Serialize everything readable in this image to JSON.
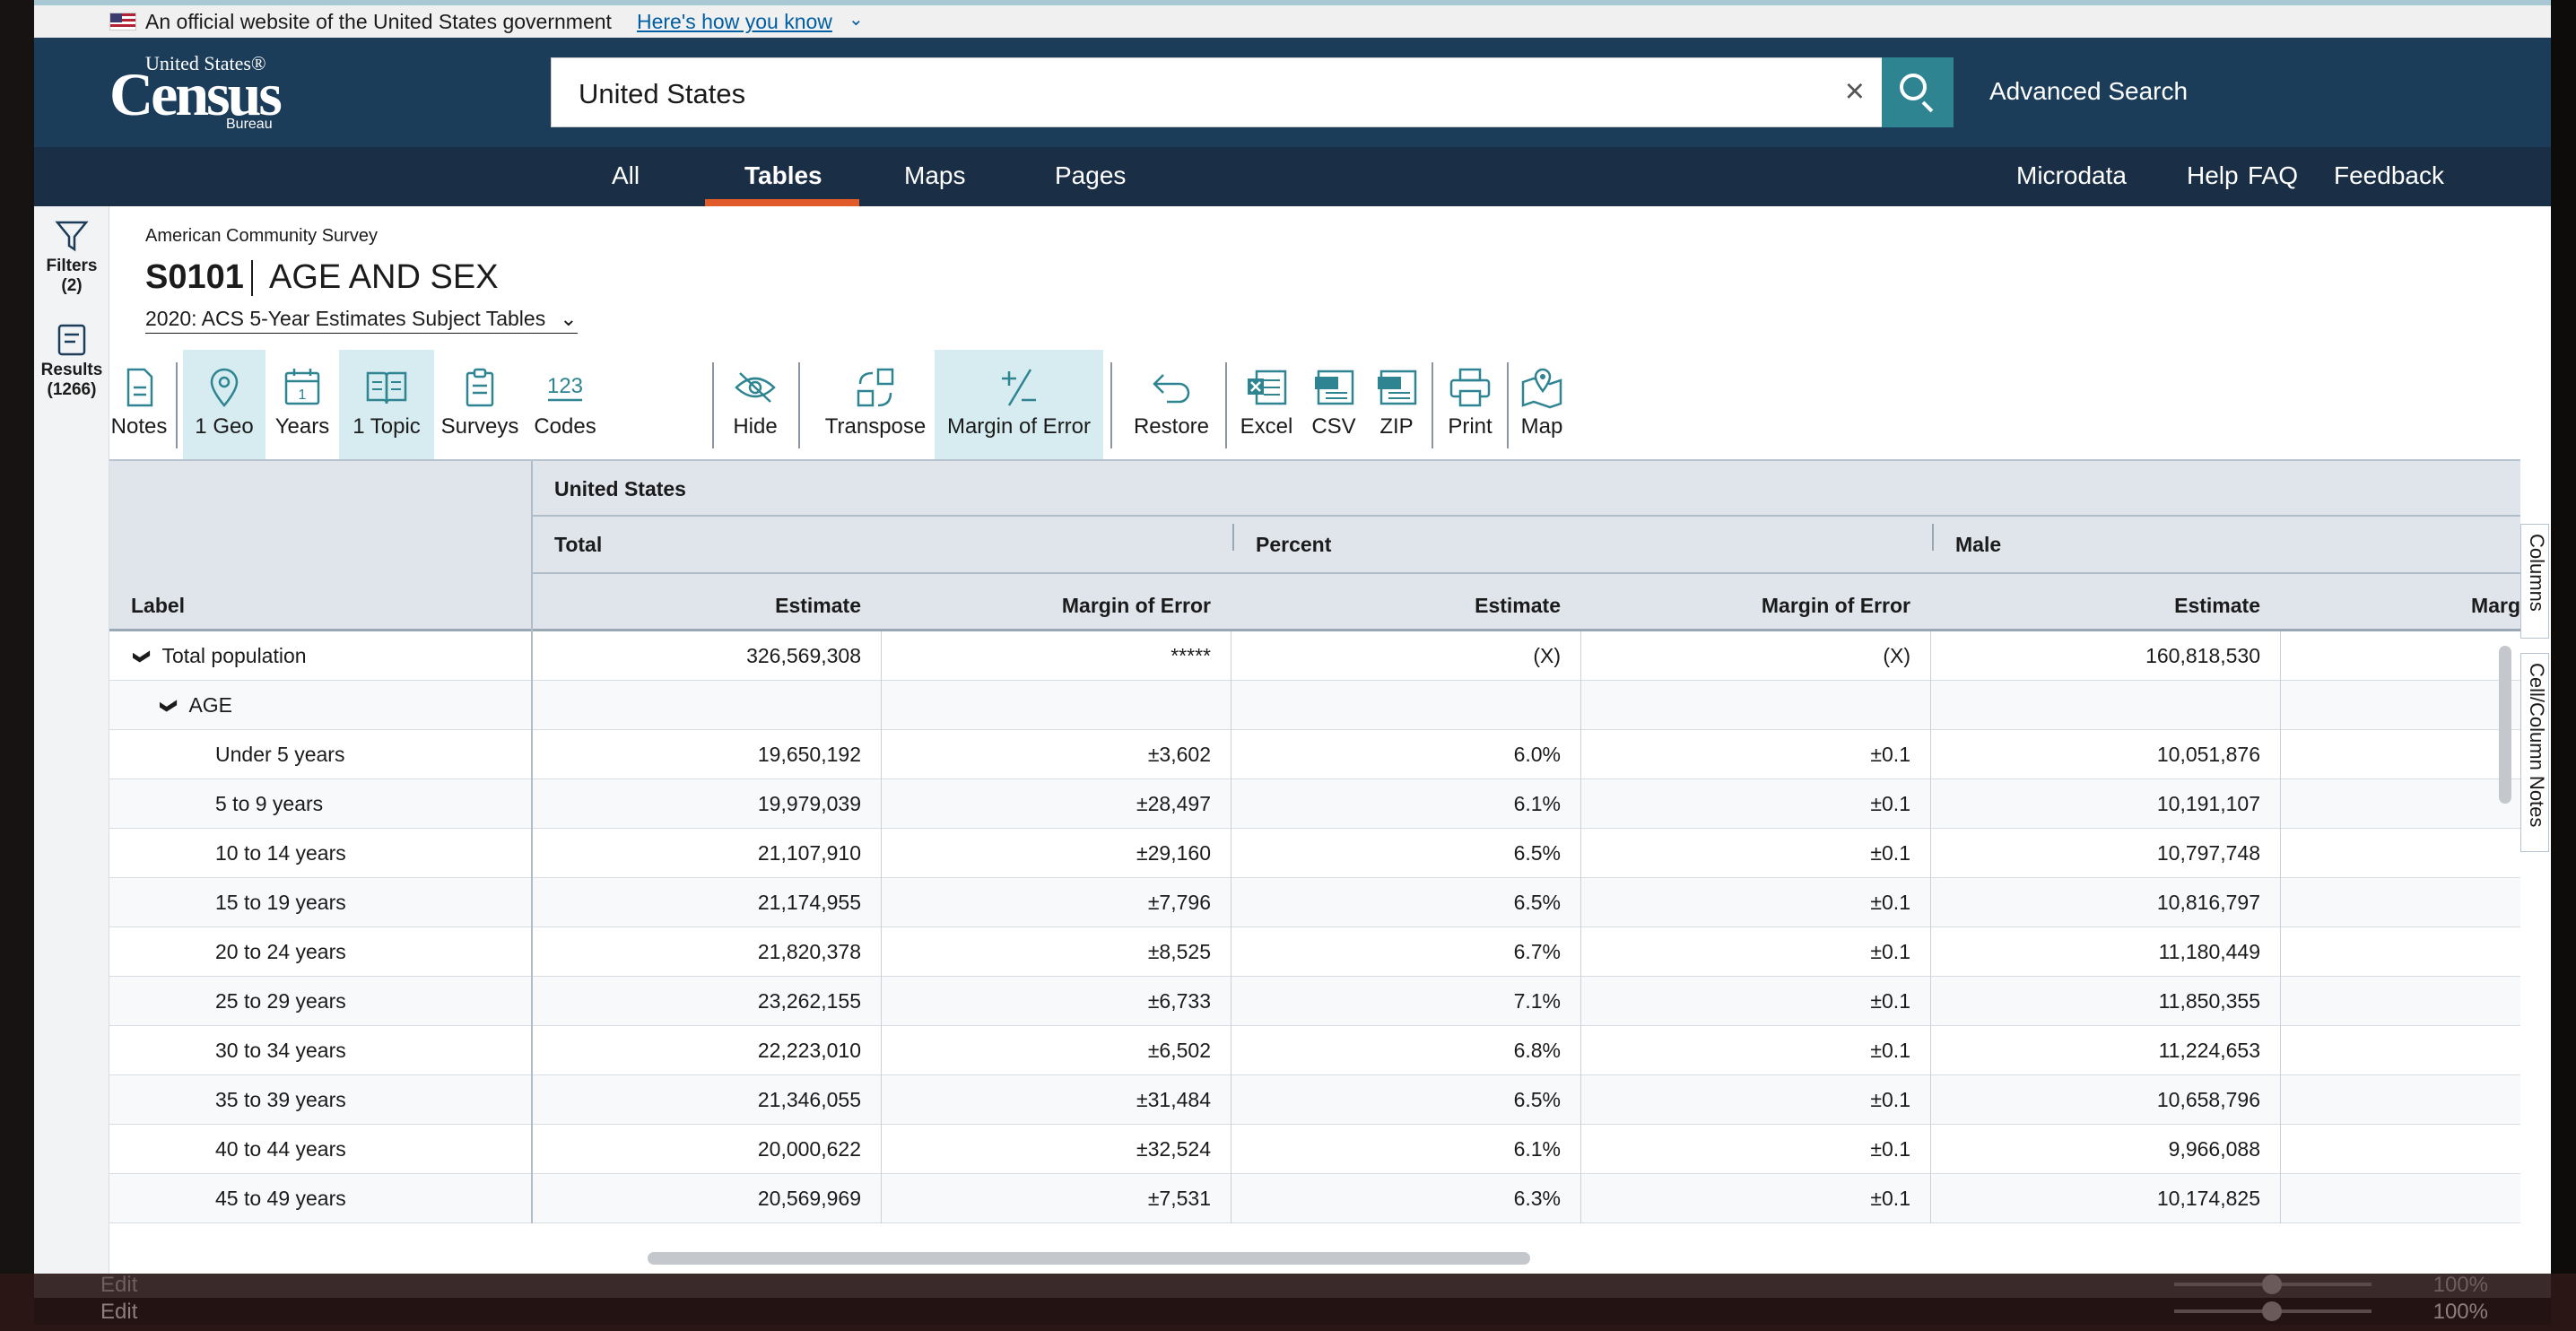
{
  "gov_banner": {
    "text": "An official website of the United States government",
    "link": "Here's how you know"
  },
  "logo": {
    "line1": "United States®",
    "line2": "Census",
    "line3": "Bureau"
  },
  "search": {
    "value": "United States",
    "clear_label": "×",
    "advanced": "Advanced Search"
  },
  "nav": {
    "tabs": [
      "All",
      "Tables",
      "Maps",
      "Pages"
    ],
    "active": "Tables",
    "right_links": [
      "Microdata",
      "Help",
      "FAQ",
      "Feedback"
    ]
  },
  "sidebar": {
    "filters_label": "Filters",
    "filters_count": "(2)",
    "results_label": "Results",
    "results_count": "(1266)"
  },
  "table_info": {
    "survey": "American Community Survey",
    "id": "S0101",
    "title": "AGE AND SEX",
    "dataset": "2020: ACS 5-Year Estimates Subject Tables"
  },
  "toolbar": {
    "items": [
      "Notes",
      "1 Geo",
      "Years",
      "1 Topic",
      "Surveys",
      "Codes",
      "Hide",
      "Transpose",
      "Margin of Error",
      "Restore",
      "Excel",
      "CSV",
      "ZIP",
      "Print",
      "Map"
    ],
    "active": [
      "1 Geo",
      "1 Topic",
      "Margin of Error"
    ],
    "codes_glyph": "123",
    "years_glyph": "1"
  },
  "grid": {
    "geo": "United States",
    "groups": [
      "Total",
      "Percent",
      "Male"
    ],
    "label_header": "Label",
    "columns": [
      "Estimate",
      "Margin of Error",
      "Estimate",
      "Margin of Error",
      "Estimate",
      "Marg"
    ],
    "rows": [
      {
        "label": "Total population",
        "level": 0,
        "expand": "❯",
        "values": [
          "326,569,308",
          "*****",
          "(X)",
          "(X)",
          "160,818,530",
          ""
        ]
      },
      {
        "label": "AGE",
        "level": 1,
        "expand": "❯",
        "values": [
          "",
          "",
          "",
          "",
          "",
          ""
        ]
      },
      {
        "label": "Under 5 years",
        "level": 2,
        "values": [
          "19,650,192",
          "±3,602",
          "6.0%",
          "±0.1",
          "10,051,876",
          ""
        ]
      },
      {
        "label": "5 to 9 years",
        "level": 2,
        "values": [
          "19,979,039",
          "±28,497",
          "6.1%",
          "±0.1",
          "10,191,107",
          ""
        ]
      },
      {
        "label": "10 to 14 years",
        "level": 2,
        "values": [
          "21,107,910",
          "±29,160",
          "6.5%",
          "±0.1",
          "10,797,748",
          ""
        ]
      },
      {
        "label": "15 to 19 years",
        "level": 2,
        "values": [
          "21,174,955",
          "±7,796",
          "6.5%",
          "±0.1",
          "10,816,797",
          ""
        ]
      },
      {
        "label": "20 to 24 years",
        "level": 2,
        "values": [
          "21,820,378",
          "±8,525",
          "6.7%",
          "±0.1",
          "11,180,449",
          ""
        ]
      },
      {
        "label": "25 to 29 years",
        "level": 2,
        "values": [
          "23,262,155",
          "±6,733",
          "7.1%",
          "±0.1",
          "11,850,355",
          ""
        ]
      },
      {
        "label": "30 to 34 years",
        "level": 2,
        "values": [
          "22,223,010",
          "±6,502",
          "6.8%",
          "±0.1",
          "11,224,653",
          ""
        ]
      },
      {
        "label": "35 to 39 years",
        "level": 2,
        "values": [
          "21,346,055",
          "±31,484",
          "6.5%",
          "±0.1",
          "10,658,796",
          ""
        ]
      },
      {
        "label": "40 to 44 years",
        "level": 2,
        "values": [
          "20,000,622",
          "±32,524",
          "6.1%",
          "±0.1",
          "9,966,088",
          ""
        ]
      },
      {
        "label": "45 to 49 years",
        "level": 2,
        "values": [
          "20,569,969",
          "±7,531",
          "6.3%",
          "±0.1",
          "10,174,825",
          ""
        ]
      }
    ]
  },
  "side_tabs": [
    "Columns",
    "Cell/Column Notes"
  ],
  "background": {
    "edit1": "Edit",
    "edit2": "Edit",
    "zoom": "100%",
    "tools": "⊞ ▤ ⊟ −",
    "plus": "+"
  },
  "colors": {
    "header_bg": "#1c3d5a",
    "nav_bg": "#1a2f45",
    "accent": "#2e8591",
    "tab_underline": "#e05a2a",
    "active_tool_bg": "#d6ecf0",
    "grid_header_bg": "#dfe5eb"
  }
}
